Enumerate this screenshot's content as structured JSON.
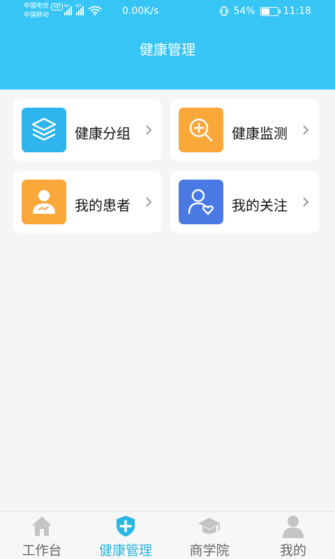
{
  "status_bar": {
    "carrier1": "中国电信",
    "carrier1_badge": "HD",
    "carrier2": "中国移动",
    "net_type": "4G",
    "net_speed": "0.00K/s",
    "battery": "54%",
    "battery_level": 0.54,
    "time": "11:18"
  },
  "header": {
    "title": "健康管理"
  },
  "menu": [
    {
      "label": "健康分组",
      "icon": "layers-icon",
      "color": "#2fb5ee"
    },
    {
      "label": "健康监测",
      "icon": "zoom-plus-icon",
      "color": "#fba83a"
    },
    {
      "label": "我的患者",
      "icon": "patient-icon",
      "color": "#fba83a"
    },
    {
      "label": "我的关注",
      "icon": "user-heart-icon",
      "color": "#4b79e3"
    }
  ],
  "tabbar": {
    "active_color": "#28b6e3",
    "inactive_color": "#666666",
    "items": [
      {
        "label": "工作台",
        "icon": "home-icon"
      },
      {
        "label": "健康管理",
        "icon": "shield-plus-icon"
      },
      {
        "label": "商学院",
        "icon": "graduation-cap-icon"
      },
      {
        "label": "我的",
        "icon": "person-icon"
      }
    ]
  }
}
